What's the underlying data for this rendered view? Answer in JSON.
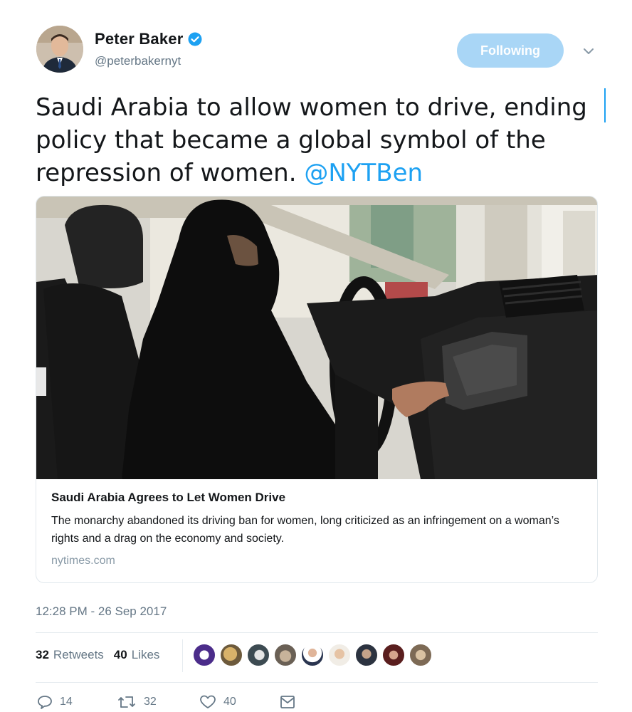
{
  "user": {
    "display_name": "Peter Baker",
    "handle": "@peterbakernyt",
    "follow_label": "Following"
  },
  "tweet": {
    "text": "Saudi Arabia to allow women to drive, ending\npolicy that became a global symbol of the\nrepression of women. ",
    "mention": "@NYTBen",
    "timestamp": "12:28 PM - 26 Sep 2017"
  },
  "card": {
    "title": "Saudi Arabia Agrees to Let Women Drive",
    "description": "The monarchy abandoned its driving ban for women, long criticized as an infringement on a woman’s rights and a drag on the economy and society.",
    "domain": "nytimes.com"
  },
  "stats": {
    "retweets_count": "32",
    "retweets_label": "Retweets",
    "likes_count": "40",
    "likes_label": "Likes"
  },
  "actions": {
    "reply_count": "14",
    "retweet_count": "32",
    "like_count": "40"
  },
  "colors": {
    "accent": "#1da1f2",
    "follow_button": "#a9d6f6",
    "muted": "#657786"
  },
  "icons": [
    "verified-badge-icon",
    "chevron-down-icon",
    "reply-icon",
    "retweet-icon",
    "heart-icon",
    "direct-message-icon"
  ]
}
